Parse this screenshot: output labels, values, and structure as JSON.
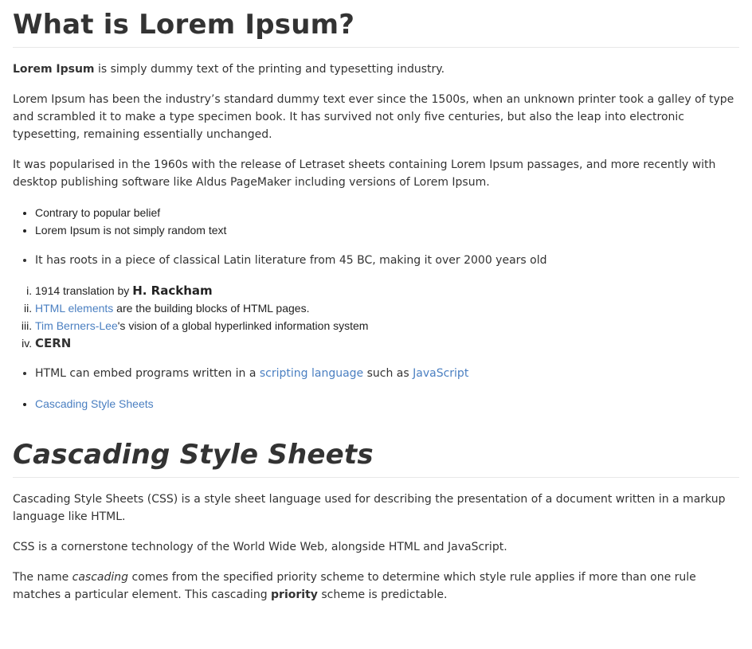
{
  "section1": {
    "heading": "What is Lorem Ipsum?",
    "p1": {
      "strong": "Lorem Ipsum",
      "rest": " is simply dummy text of the printing and typesetting industry."
    },
    "p2": "Lorem Ipsum has been the industry’s standard dummy text ever since the 1500s, when an unknown printer took a galley of type and scrambled it to make a type specimen book. It has survived not only five centuries, but also the leap into electronic typesetting, remaining essentially unchanged.",
    "p3": "It was popularised in the 1960s with the release of Letraset sheets containing Lorem Ipsum passages, and more recently with desktop publishing software like Aldus PageMaker including versions of Lorem Ipsum.",
    "list1": [
      "Contrary to popular belief",
      "Lorem Ipsum is not simply random text"
    ],
    "list2_item": "It has roots in a piece of classical Latin literature from 45 BC, making it over 2000 years old",
    "ordered": {
      "i_text": "1914 translation by ",
      "i_strong": "H. Rackham",
      "ii_link": "HTML elements",
      "ii_text": " are the building blocks of HTML pages.",
      "iii_link": "Tim Berners-Lee",
      "iii_text": "'s vision of a global hyperlinked information system",
      "iv_strong": "CERN"
    },
    "list3": {
      "text1": "HTML can embed programs written in a ",
      "link1": "scripting language",
      "text2": " such as ",
      "link2": "JavaScript"
    },
    "list4_link": "Cascading Style Sheets"
  },
  "section2": {
    "heading": "Cascading Style Sheets",
    "p1": "Cascading Style Sheets (CSS) is a style sheet language used for describing the presentation of a document written in a markup language like HTML.",
    "p2": "CSS is a cornerstone technology of the World Wide Web, alongside HTML and JavaScript.",
    "p3": {
      "text1": "The name ",
      "em": "cascading",
      "text2": " comes from the specified priority scheme to determine which style rule applies if more than one rule matches a particular element. This cascading ",
      "strong": "priority",
      "text3": " scheme is predictable."
    }
  }
}
